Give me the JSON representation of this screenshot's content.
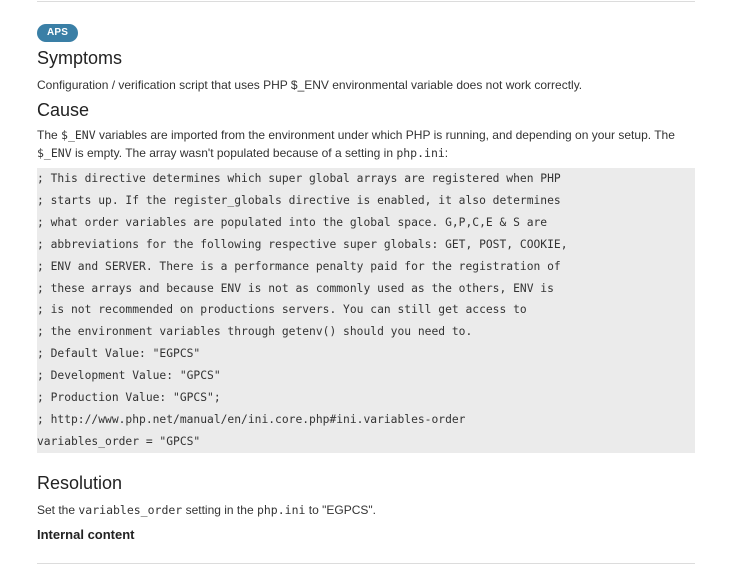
{
  "badge": "APS",
  "symptoms": {
    "heading": "Symptoms",
    "text": "Configuration / verification script that uses PHP $_ENV environmental variable does not work correctly."
  },
  "cause": {
    "heading": "Cause",
    "text_part1": "The ",
    "code1": "$_ENV",
    "text_part2": " variables are imported from the environment under which PHP is running, and depending on your setup. The ",
    "code2": "$_ENV",
    "text_part3": " is empty. The array wasn't populated because of a setting in ",
    "code3": "php.ini",
    "text_part4": ":"
  },
  "code_block": {
    "lines": [
      "; This directive determines which super global arrays are registered when PHP",
      "; starts up. If the register_globals directive is enabled, it also determines",
      "; what order variables are populated into the global space. G,P,C,E & S are",
      "; abbreviations for the following respective super globals: GET, POST, COOKIE,",
      "; ENV and SERVER. There is a performance penalty paid for the registration of",
      "; these arrays and because ENV is not as commonly used as the others, ENV is",
      "; is not recommended on productions servers. You can still get access to",
      "; the environment variables through getenv() should you need to.",
      "; Default Value: \"EGPCS\"",
      "; Development Value: \"GPCS\"",
      "; Production Value: \"GPCS\";",
      "; http://www.php.net/manual/en/ini.core.php#ini.variables-order",
      "variables_order = \"GPCS\""
    ]
  },
  "resolution": {
    "heading": "Resolution",
    "text_part1": "Set the ",
    "code1": "variables_order",
    "text_part2": " setting in the ",
    "code2": "php.ini",
    "text_part3": " to \"EGPCS\"."
  },
  "internal_content": "Internal content"
}
